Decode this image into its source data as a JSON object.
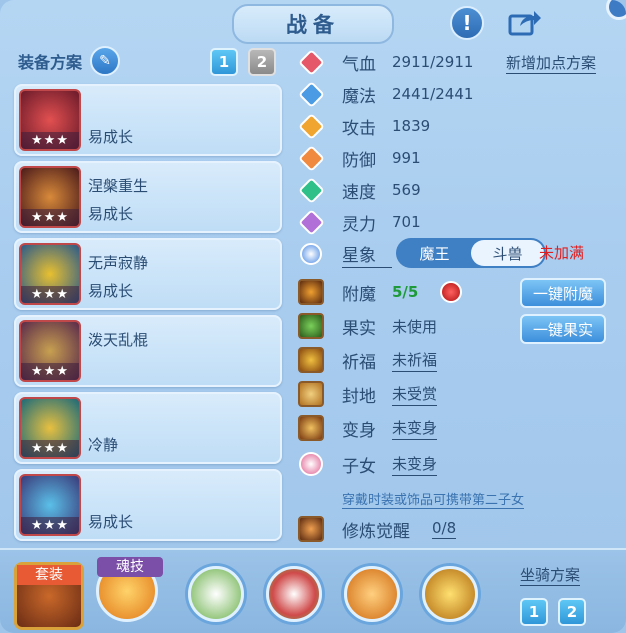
{
  "header": {
    "title": "战备",
    "help_icon": "exclamation-icon",
    "share_icon": "share-icon"
  },
  "left": {
    "title": "装备方案",
    "pages": [
      "1",
      "2"
    ],
    "items": [
      {
        "name": "",
        "desc": "易成长",
        "stars": "★★★",
        "color": "#b83030"
      },
      {
        "name": "涅槃重生",
        "desc": "易成长",
        "stars": "★★★",
        "color": "#6a2a2a"
      },
      {
        "name": "无声寂静",
        "desc": "易成长",
        "stars": "★★★",
        "color": "#3a6a8a"
      },
      {
        "name": "泼天乱棍",
        "desc": "",
        "stars": "★★★",
        "color": "#5a3a4a"
      },
      {
        "name": "",
        "desc": "冷静",
        "stars": "★★★",
        "color": "#3a7a8a"
      },
      {
        "name": "",
        "desc": "易成长",
        "stars": "★★★",
        "color": "#4a5a8a"
      }
    ]
  },
  "stats": {
    "add_plan": "新增加点方案",
    "attrs": [
      {
        "label": "气血",
        "value": "2911/2911",
        "color": "#e4586a"
      },
      {
        "label": "魔法",
        "value": "2441/2441",
        "color": "#4a9ae4"
      },
      {
        "label": "攻击",
        "value": "1839",
        "color": "#f0a530"
      },
      {
        "label": "防御",
        "value": "991",
        "color": "#f08a40"
      },
      {
        "label": "速度",
        "value": "569",
        "color": "#2fc08a"
      },
      {
        "label": "灵力",
        "value": "701",
        "color": "#b070d8"
      }
    ],
    "xingxiang": {
      "label": "星象",
      "options": [
        "魔王",
        "斗兽"
      ],
      "status": "未加满"
    },
    "fumo": {
      "label": "附魔",
      "value": "5/5",
      "button": "一键附魔"
    },
    "guoshi": {
      "label": "果实",
      "value": "未使用",
      "button": "一键果实"
    },
    "qifu": {
      "label": "祈福",
      "value": "未祈福"
    },
    "fengdi": {
      "label": "封地",
      "value": "未受赏"
    },
    "bianshen": {
      "label": "变身",
      "value": "未变身"
    },
    "zinv": {
      "label": "子女",
      "value": "未变身",
      "hint": "穿戴时装或饰品可携带第二子女"
    },
    "xiulian": {
      "label": "修炼觉醒",
      "value": "0/8"
    }
  },
  "bottom": {
    "set_label": "套装",
    "skill_label": "魂技",
    "mount_title": "坐骑方案",
    "mount_pages": [
      "1",
      "2"
    ]
  }
}
